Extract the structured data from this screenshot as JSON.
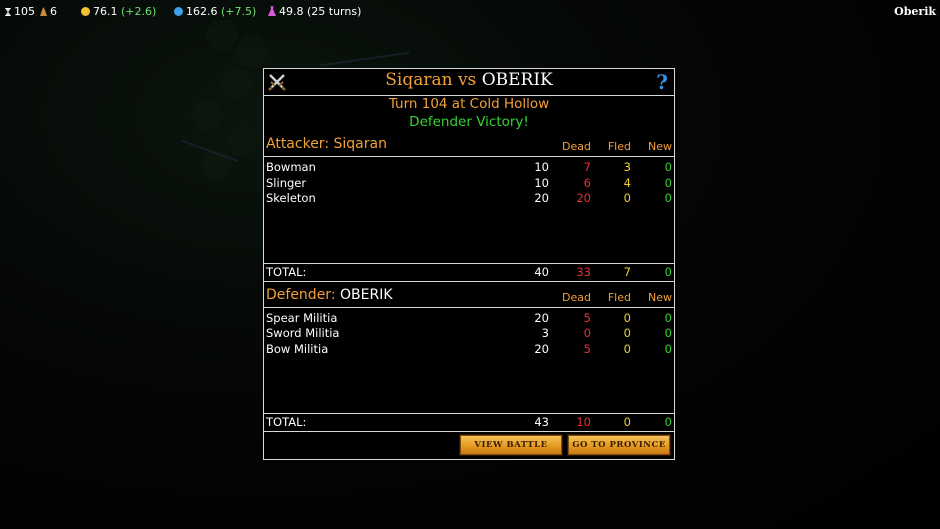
{
  "topbar": {
    "turn": "105",
    "population": "6",
    "gold": "76.1",
    "gold_income": "(+2.6)",
    "mana": "162.6",
    "mana_income": "(+7.5)",
    "research": "49.8 (25 turns)",
    "player_name": "Oberik",
    "icons": [
      "hourglass-icon",
      "population-icon",
      "gold-coin-icon",
      "mana-orb-icon",
      "research-flask-icon"
    ]
  },
  "dialog": {
    "attacker_name": "Siqaran",
    "vs": "vs",
    "defender_name": "OBERIK",
    "turn_location": "Turn 104 at Cold Hollow",
    "result": "Defender Victory!",
    "help": "?",
    "columns": {
      "dead": "Dead",
      "fled": "Fled",
      "new": "New"
    },
    "attacker": {
      "label": "Attacker:",
      "name": "Siqaran",
      "units": [
        {
          "name": "Bowman",
          "count": "10",
          "dead": "7",
          "fled": "3",
          "new": "0"
        },
        {
          "name": "Slinger",
          "count": "10",
          "dead": "6",
          "fled": "4",
          "new": "0"
        },
        {
          "name": "Skeleton",
          "count": "20",
          "dead": "20",
          "fled": "0",
          "new": "0"
        }
      ],
      "total": {
        "label": "TOTAL:",
        "count": "40",
        "dead": "33",
        "fled": "7",
        "new": "0"
      }
    },
    "defender": {
      "label": "Defender:",
      "name": "OBERIK",
      "units": [
        {
          "name": "Spear Militia",
          "count": "20",
          "dead": "5",
          "fled": "0",
          "new": "0"
        },
        {
          "name": "Sword Militia",
          "count": "3",
          "dead": "0",
          "fled": "0",
          "new": "0"
        },
        {
          "name": "Bow Militia",
          "count": "20",
          "dead": "5",
          "fled": "0",
          "new": "0"
        }
      ],
      "total": {
        "label": "TOTAL:",
        "count": "43",
        "dead": "10",
        "fled": "0",
        "new": "0"
      }
    },
    "buttons": {
      "view_battle": "VIEW BATTLE",
      "go_to_province": "GO TO PROVINCE"
    }
  },
  "colors": {
    "accent_orange": "#f2a03a",
    "victory_green": "#34d334",
    "dead_red": "#e83030",
    "fled_yellow": "#f0d030"
  }
}
